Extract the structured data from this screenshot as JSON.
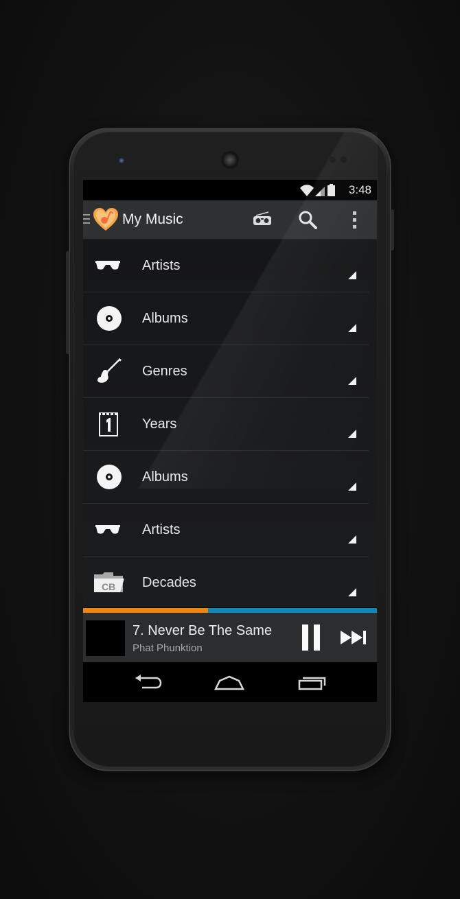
{
  "status": {
    "time": "3:48",
    "icons": [
      "wifi-icon",
      "signal-icon",
      "battery-icon"
    ]
  },
  "actionbar": {
    "title": "My Music",
    "actions": [
      "radio-icon",
      "search-icon",
      "overflow-menu-icon"
    ]
  },
  "list": {
    "items": [
      {
        "label": "Artists",
        "icon": "sunglasses-icon"
      },
      {
        "label": "Albums",
        "icon": "vinyl-record-icon"
      },
      {
        "label": "Genres",
        "icon": "guitar-icon"
      },
      {
        "label": "Years",
        "icon": "calendar-icon"
      },
      {
        "label": "Albums",
        "icon": "vinyl-record-icon"
      },
      {
        "label": "Artists",
        "icon": "sunglasses-icon"
      },
      {
        "label": "Decades",
        "icon": "folder-cb-icon"
      }
    ]
  },
  "playback": {
    "progress": 0.425,
    "progress_color": "#f0860f",
    "track_color": "#1189b8"
  },
  "now_playing": {
    "title": "7. Never Be The Same",
    "artist": "Phat Phunktion",
    "controls": [
      "pause-icon",
      "skip-next-icon"
    ]
  },
  "navbar": {
    "buttons": [
      "back-icon",
      "home-icon",
      "recent-apps-icon"
    ]
  },
  "colors": {
    "actionbar_bg": "#2f3032",
    "list_bg": "#1a1b1d",
    "accent_orange": "#f0860f",
    "accent_blue": "#1189b8"
  }
}
